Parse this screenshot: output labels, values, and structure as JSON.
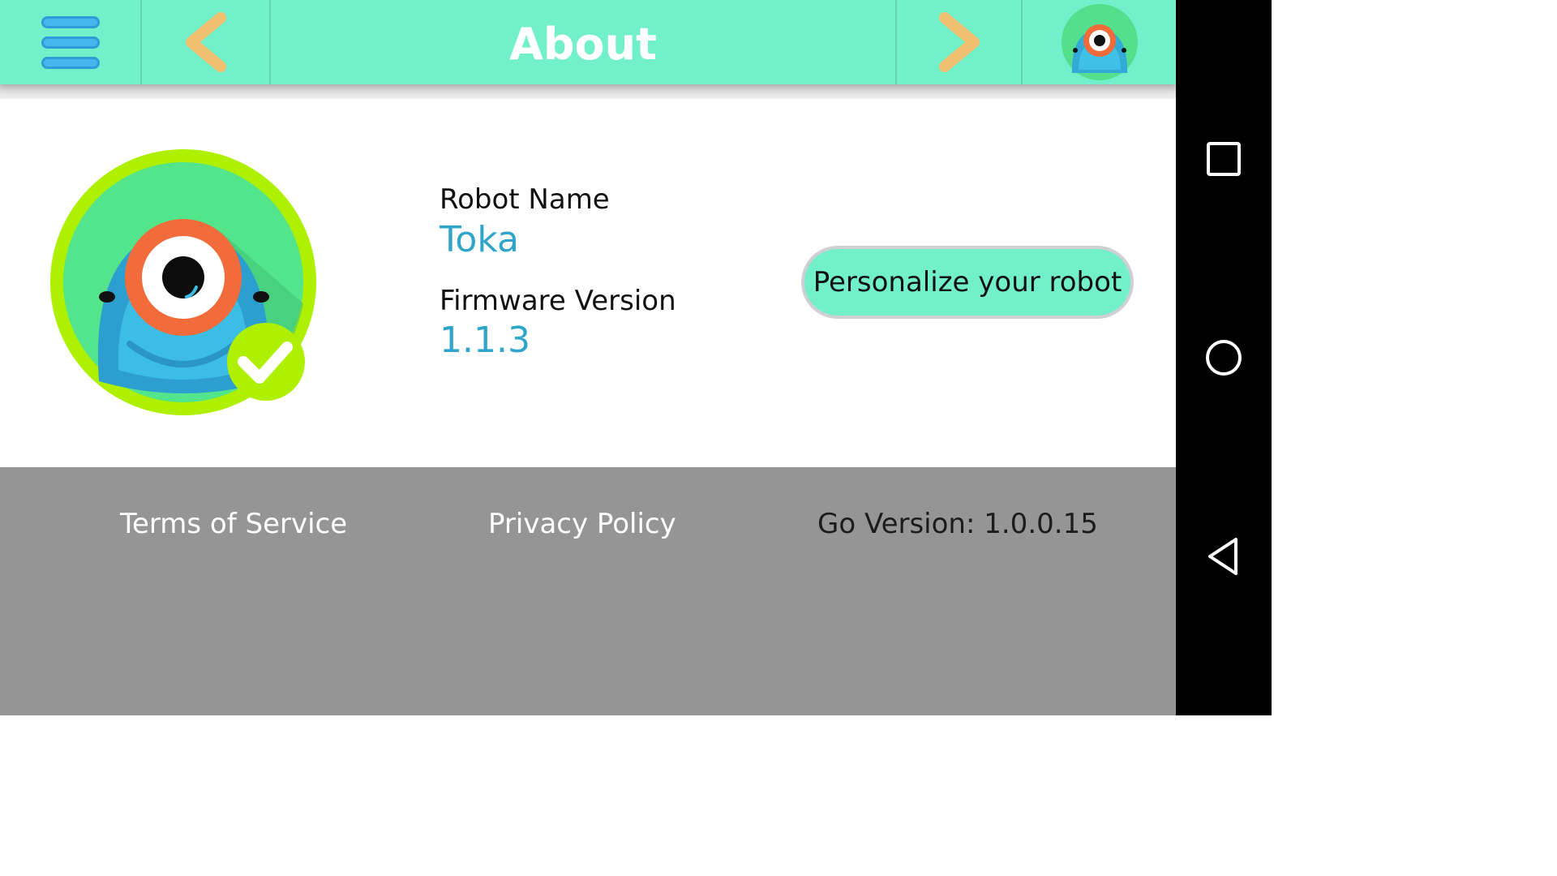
{
  "header": {
    "title": "About",
    "menu_icon": "hamburger-menu-icon",
    "back_icon": "chevron-left-icon",
    "forward_icon": "chevron-right-icon",
    "robot_icon": "robot-avatar-icon"
  },
  "robot": {
    "name_label": "Robot Name",
    "name_value": "Toka",
    "firmware_label": "Firmware Version",
    "firmware_value": "1.1.3",
    "connected_icon": "check-badge-icon"
  },
  "personalize_button": "Personalize your robot",
  "footer": {
    "terms": "Terms of Service",
    "privacy": "Privacy Policy",
    "go_version": "Go Version: 1.0.0.15"
  },
  "nav": {
    "recents_icon": "square-recents-icon",
    "home_icon": "circle-home-icon",
    "back_icon": "triangle-back-icon"
  },
  "colors": {
    "header": "#72f0c9",
    "accent_text": "#2fa6c9",
    "arrow": "#f0c070",
    "footer": "#959595",
    "badge": "#aef000"
  }
}
